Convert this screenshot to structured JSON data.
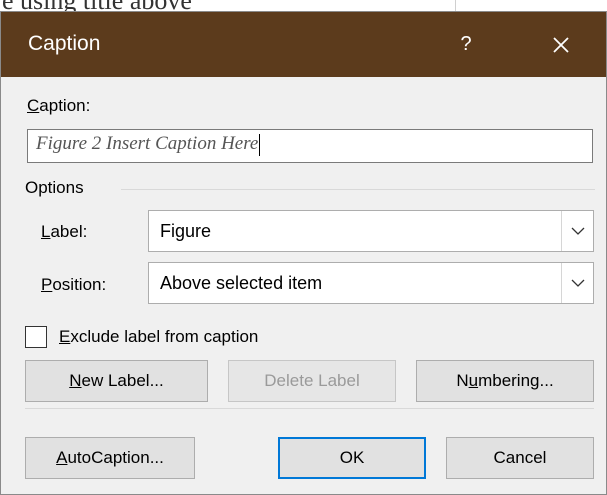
{
  "background": {
    "text": "e using title above"
  },
  "dialog": {
    "title": "Caption",
    "help_label": "?",
    "close_icon": "close-icon",
    "titlebar_color": "#5c3b1c"
  },
  "caption": {
    "label_underlined": "C",
    "label_rest": "aption:",
    "value": "Figure 2 Insert Caption Here"
  },
  "options": {
    "group_label": "Options",
    "label_field": {
      "label_underlined": "L",
      "label_rest": "abel:",
      "value": "Figure"
    },
    "position_field": {
      "label_underlined": "P",
      "label_rest": "osition:",
      "value": "Above selected item"
    },
    "exclude_checkbox": {
      "checked": false,
      "label_underlined": "E",
      "label_rest": "xclude label from caption"
    }
  },
  "buttons": {
    "new_label": {
      "underlined": "N",
      "rest": "ew Label..."
    },
    "delete_label": "Delete Label",
    "numbering": {
      "pre": "N",
      "underlined": "u",
      "rest": "mbering..."
    },
    "autocaption": {
      "underlined": "A",
      "rest": "utoCaption..."
    },
    "ok": "OK",
    "cancel": "Cancel"
  },
  "accent_color": "#0078d7"
}
